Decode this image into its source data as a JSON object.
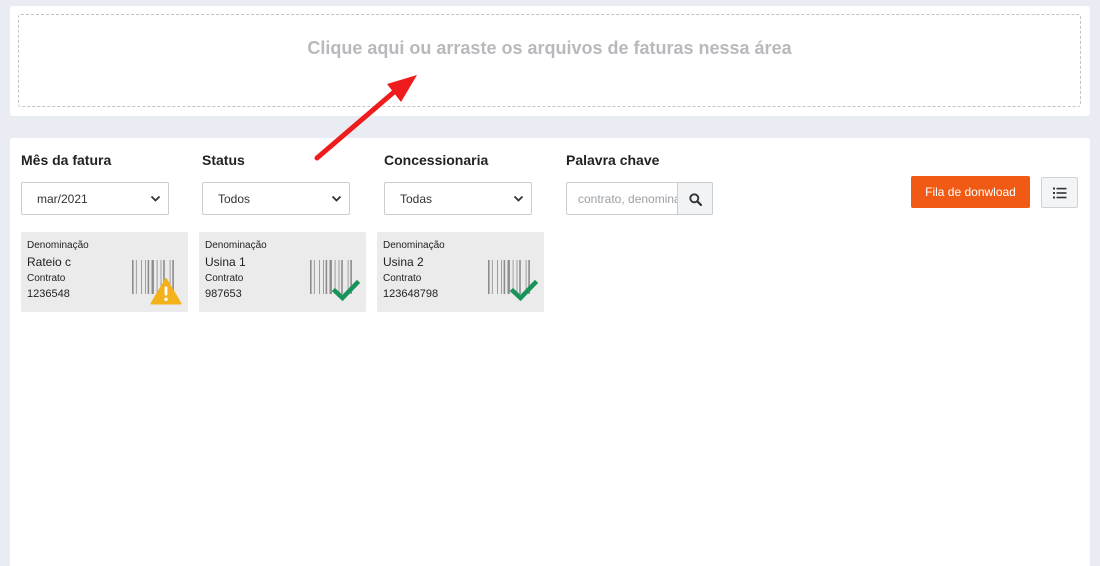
{
  "dropzone": {
    "text": "Clique aqui ou arraste os arquivos de faturas nessa área"
  },
  "filters": {
    "month": {
      "label": "Mês da fatura",
      "value": "mar/2021"
    },
    "status": {
      "label": "Status",
      "value": "Todos"
    },
    "utility": {
      "label": "Concessionaria",
      "value": "Todas"
    },
    "keyword": {
      "label": "Palavra chave",
      "placeholder": "contrato, denominação"
    }
  },
  "actions": {
    "download_queue_label": "Fila de donwload"
  },
  "cards": [
    {
      "denomination_label": "Denominação",
      "denomination": "Rateio c",
      "contract_label": "Contrato",
      "contract": "1236548",
      "status_icon": "warning-icon"
    },
    {
      "denomination_label": "Denominação",
      "denomination": "Usina 1",
      "contract_label": "Contrato",
      "contract": "987653",
      "status_icon": "check-icon"
    },
    {
      "denomination_label": "Denominação",
      "denomination": "Usina 2",
      "contract_label": "Contrato",
      "contract": "123648798",
      "status_icon": "check-icon"
    }
  ],
  "colors": {
    "accent": "#f05a14",
    "success": "#18935a",
    "warning": "#f3b21c",
    "annotation": "#ee1c1c"
  },
  "icons": {
    "search": "search-icon",
    "list": "list-icon",
    "barcode": "barcode-icon",
    "chevron": "chevron-down-icon"
  }
}
